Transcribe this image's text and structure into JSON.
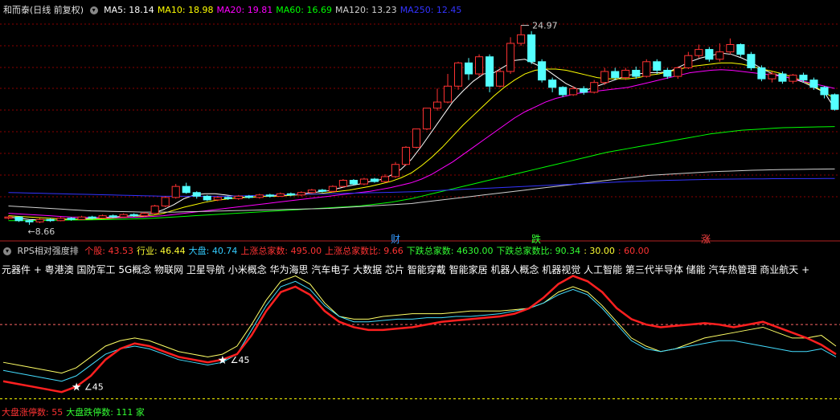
{
  "header": {
    "stock_title": "和而泰(日线 前复权)",
    "ma": [
      {
        "label": "MA5: 18.14",
        "color": "#ffffff"
      },
      {
        "label": "MA10: 18.98",
        "color": "#ffff00"
      },
      {
        "label": "MA20: 19.81",
        "color": "#ff00ff"
      },
      {
        "label": "MA60: 16.69",
        "color": "#00ff00"
      },
      {
        "label": "MA120: 13.23",
        "color": "#d0d0d0"
      },
      {
        "label": "MA250: 12.45",
        "color": "#3333ff"
      }
    ]
  },
  "price_chart": {
    "high_label": "24.97",
    "low_label": "8.66",
    "event_tags": [
      {
        "text": "财",
        "color": "#3399ff"
      },
      {
        "text": "跌",
        "color": "#33ff33"
      },
      {
        "text": "涨",
        "color": "#ff4444"
      }
    ],
    "candles": [
      {
        "o": 9.2,
        "c": 9.3,
        "h": 9.4,
        "l": 9.1
      },
      {
        "o": 9.3,
        "c": 9.0,
        "h": 9.35,
        "l": 8.9
      },
      {
        "o": 9.0,
        "c": 8.9,
        "h": 9.1,
        "l": 8.66
      },
      {
        "o": 8.9,
        "c": 9.1,
        "h": 9.2,
        "l": 8.8
      },
      {
        "o": 9.1,
        "c": 9.0,
        "h": 9.2,
        "l": 8.9
      },
      {
        "o": 9.0,
        "c": 9.2,
        "h": 9.3,
        "l": 8.95
      },
      {
        "o": 9.2,
        "c": 9.1,
        "h": 9.3,
        "l": 9.0
      },
      {
        "o": 9.1,
        "c": 9.3,
        "h": 9.4,
        "l": 9.05
      },
      {
        "o": 9.3,
        "c": 9.2,
        "h": 9.4,
        "l": 9.1
      },
      {
        "o": 9.2,
        "c": 9.4,
        "h": 9.5,
        "l": 9.15
      },
      {
        "o": 9.4,
        "c": 9.3,
        "h": 9.5,
        "l": 9.2
      },
      {
        "o": 9.3,
        "c": 9.5,
        "h": 9.6,
        "l": 9.25
      },
      {
        "o": 9.5,
        "c": 9.4,
        "h": 9.6,
        "l": 9.3
      },
      {
        "o": 9.4,
        "c": 9.6,
        "h": 9.7,
        "l": 9.35
      },
      {
        "o": 9.6,
        "c": 10.2,
        "h": 10.3,
        "l": 9.55
      },
      {
        "o": 10.2,
        "c": 10.9,
        "h": 11.0,
        "l": 10.1
      },
      {
        "o": 10.9,
        "c": 11.8,
        "h": 12.0,
        "l": 10.8
      },
      {
        "o": 11.8,
        "c": 11.3,
        "h": 12.1,
        "l": 11.2
      },
      {
        "o": 11.3,
        "c": 11.0,
        "h": 11.4,
        "l": 10.8
      },
      {
        "o": 11.0,
        "c": 10.7,
        "h": 11.1,
        "l": 10.6
      },
      {
        "o": 10.7,
        "c": 10.9,
        "h": 11.0,
        "l": 10.6
      },
      {
        "o": 10.9,
        "c": 10.8,
        "h": 11.0,
        "l": 10.7
      },
      {
        "o": 10.8,
        "c": 11.0,
        "h": 11.1,
        "l": 10.7
      },
      {
        "o": 11.0,
        "c": 10.9,
        "h": 11.1,
        "l": 10.8
      },
      {
        "o": 10.9,
        "c": 11.1,
        "h": 11.2,
        "l": 10.8
      },
      {
        "o": 11.1,
        "c": 11.0,
        "h": 11.2,
        "l": 10.9
      },
      {
        "o": 11.0,
        "c": 11.2,
        "h": 11.3,
        "l": 10.95
      },
      {
        "o": 11.2,
        "c": 11.1,
        "h": 11.3,
        "l": 11.0
      },
      {
        "o": 11.1,
        "c": 11.3,
        "h": 11.4,
        "l": 11.0
      },
      {
        "o": 11.3,
        "c": 11.5,
        "h": 11.6,
        "l": 11.2
      },
      {
        "o": 11.5,
        "c": 11.4,
        "h": 11.6,
        "l": 11.3
      },
      {
        "o": 11.4,
        "c": 11.8,
        "h": 11.9,
        "l": 11.3
      },
      {
        "o": 11.8,
        "c": 12.3,
        "h": 12.4,
        "l": 11.7
      },
      {
        "o": 12.3,
        "c": 12.0,
        "h": 12.4,
        "l": 11.9
      },
      {
        "o": 12.0,
        "c": 12.4,
        "h": 12.5,
        "l": 11.9
      },
      {
        "o": 12.4,
        "c": 12.2,
        "h": 12.5,
        "l": 12.1
      },
      {
        "o": 12.2,
        "c": 12.6,
        "h": 12.8,
        "l": 12.1
      },
      {
        "o": 12.6,
        "c": 13.6,
        "h": 13.8,
        "l": 12.5
      },
      {
        "o": 13.6,
        "c": 15.0,
        "h": 15.1,
        "l": 13.5
      },
      {
        "o": 15.0,
        "c": 16.5,
        "h": 16.5,
        "l": 14.9
      },
      {
        "o": 16.5,
        "c": 18.2,
        "h": 18.2,
        "l": 16.4
      },
      {
        "o": 18.2,
        "c": 18.7,
        "h": 19.8,
        "l": 18.0
      },
      {
        "o": 18.7,
        "c": 20.0,
        "h": 21.0,
        "l": 18.6
      },
      {
        "o": 20.0,
        "c": 21.9,
        "h": 22.0,
        "l": 19.7
      },
      {
        "o": 21.9,
        "c": 21.0,
        "h": 22.3,
        "l": 20.5
      },
      {
        "o": 21.0,
        "c": 22.4,
        "h": 22.6,
        "l": 20.8
      },
      {
        "o": 22.4,
        "c": 20.0,
        "h": 22.6,
        "l": 19.5
      },
      {
        "o": 20.0,
        "c": 21.2,
        "h": 21.5,
        "l": 19.9
      },
      {
        "o": 21.2,
        "c": 23.5,
        "h": 24.0,
        "l": 21.0
      },
      {
        "o": 23.5,
        "c": 24.2,
        "h": 24.97,
        "l": 23.3
      },
      {
        "o": 24.2,
        "c": 22.0,
        "h": 24.5,
        "l": 21.8
      },
      {
        "o": 22.0,
        "c": 20.5,
        "h": 22.2,
        "l": 20.3
      },
      {
        "o": 20.5,
        "c": 19.9,
        "h": 20.7,
        "l": 19.5
      },
      {
        "o": 19.9,
        "c": 19.3,
        "h": 20.0,
        "l": 19.1
      },
      {
        "o": 19.3,
        "c": 19.8,
        "h": 20.0,
        "l": 19.2
      },
      {
        "o": 19.8,
        "c": 19.5,
        "h": 20.0,
        "l": 19.3
      },
      {
        "o": 19.5,
        "c": 20.3,
        "h": 20.5,
        "l": 19.4
      },
      {
        "o": 20.3,
        "c": 21.2,
        "h": 21.5,
        "l": 20.1
      },
      {
        "o": 21.2,
        "c": 20.7,
        "h": 21.5,
        "l": 20.5
      },
      {
        "o": 20.7,
        "c": 21.3,
        "h": 21.5,
        "l": 20.5
      },
      {
        "o": 21.3,
        "c": 20.8,
        "h": 21.6,
        "l": 20.6
      },
      {
        "o": 20.8,
        "c": 22.0,
        "h": 22.2,
        "l": 20.7
      },
      {
        "o": 22.0,
        "c": 21.3,
        "h": 22.2,
        "l": 21.0
      },
      {
        "o": 21.3,
        "c": 20.8,
        "h": 21.5,
        "l": 20.6
      },
      {
        "o": 20.8,
        "c": 21.5,
        "h": 21.6,
        "l": 20.6
      },
      {
        "o": 21.5,
        "c": 22.5,
        "h": 22.8,
        "l": 21.4
      },
      {
        "o": 22.5,
        "c": 23.0,
        "h": 23.4,
        "l": 22.3
      },
      {
        "o": 23.0,
        "c": 22.2,
        "h": 23.2,
        "l": 22.0
      },
      {
        "o": 22.2,
        "c": 22.8,
        "h": 23.5,
        "l": 22.0
      },
      {
        "o": 22.8,
        "c": 23.4,
        "h": 23.9,
        "l": 22.6
      },
      {
        "o": 23.4,
        "c": 22.6,
        "h": 23.5,
        "l": 22.4
      },
      {
        "o": 22.6,
        "c": 21.5,
        "h": 22.8,
        "l": 21.3
      },
      {
        "o": 21.5,
        "c": 20.6,
        "h": 21.7,
        "l": 20.4
      },
      {
        "o": 20.6,
        "c": 21.0,
        "h": 21.2,
        "l": 20.3
      },
      {
        "o": 21.0,
        "c": 20.4,
        "h": 21.2,
        "l": 20.2
      },
      {
        "o": 20.4,
        "c": 20.9,
        "h": 21.0,
        "l": 20.2
      },
      {
        "o": 20.9,
        "c": 20.5,
        "h": 21.1,
        "l": 20.3
      },
      {
        "o": 20.5,
        "c": 19.9,
        "h": 20.7,
        "l": 19.7
      },
      {
        "o": 19.9,
        "c": 19.3,
        "h": 20.0,
        "l": 19.0
      },
      {
        "o": 19.3,
        "c": 18.1,
        "h": 19.4,
        "l": 18.0
      }
    ],
    "ma_values": {
      "ma5": [
        9.3,
        9.2,
        9.1,
        9.05,
        9.05,
        9.06,
        9.1,
        9.14,
        9.2,
        9.25,
        9.3,
        9.35,
        9.4,
        9.45,
        9.6,
        9.9,
        10.3,
        10.8,
        11.1,
        11.2,
        11.2,
        11.1,
        11.0,
        10.9,
        10.95,
        11.0,
        11.05,
        11.1,
        11.15,
        11.25,
        11.35,
        11.45,
        11.65,
        11.85,
        12.0,
        12.2,
        12.35,
        12.7,
        13.2,
        14.0,
        15.1,
        16.3,
        17.5,
        18.7,
        19.6,
        20.4,
        21.0,
        21.1,
        21.6,
        22.1,
        22.2,
        21.8,
        21.4,
        20.8,
        20.2,
        19.8,
        19.7,
        20.0,
        20.3,
        20.6,
        20.9,
        21.0,
        21.1,
        21.1,
        21.2,
        21.6,
        22.0,
        22.3,
        22.5,
        22.7,
        22.6,
        22.3,
        21.9,
        21.4,
        21.0,
        20.8,
        20.6,
        20.3,
        19.9,
        19.5,
        18.14
      ],
      "ma10": [
        9.4,
        9.35,
        9.3,
        9.25,
        9.2,
        9.15,
        9.12,
        9.1,
        9.12,
        9.15,
        9.2,
        9.25,
        9.3,
        9.35,
        9.45,
        9.6,
        9.85,
        10.1,
        10.3,
        10.5,
        10.65,
        10.75,
        10.85,
        10.9,
        10.95,
        11.0,
        11.0,
        11.05,
        11.1,
        11.15,
        11.2,
        11.3,
        11.4,
        11.5,
        11.65,
        11.8,
        12.0,
        12.2,
        12.5,
        12.9,
        13.5,
        14.2,
        15.0,
        15.9,
        16.8,
        17.6,
        18.4,
        19.2,
        19.9,
        20.5,
        21.0,
        21.3,
        21.4,
        21.4,
        21.3,
        21.1,
        20.9,
        20.7,
        20.6,
        20.6,
        20.6,
        20.7,
        20.9,
        21.0,
        21.2,
        21.4,
        21.6,
        21.7,
        21.8,
        21.9,
        21.9,
        21.8,
        21.6,
        21.4,
        21.2,
        21.0,
        20.7,
        20.4,
        20.0,
        19.5,
        18.98
      ],
      "ma20": [
        9.6,
        9.55,
        9.5,
        9.45,
        9.4,
        9.35,
        9.3,
        9.28,
        9.26,
        9.25,
        9.25,
        9.26,
        9.28,
        9.3,
        9.35,
        9.4,
        9.5,
        9.6,
        9.7,
        9.8,
        9.9,
        10.0,
        10.1,
        10.2,
        10.3,
        10.4,
        10.5,
        10.6,
        10.7,
        10.8,
        10.9,
        11.0,
        11.1,
        11.2,
        11.3,
        11.4,
        11.55,
        11.7,
        11.9,
        12.1,
        12.4,
        12.8,
        13.3,
        13.8,
        14.4,
        15.0,
        15.6,
        16.2,
        16.8,
        17.4,
        17.9,
        18.3,
        18.7,
        19.0,
        19.2,
        19.4,
        19.5,
        19.6,
        19.7,
        19.8,
        19.9,
        20.1,
        20.3,
        20.5,
        20.7,
        20.9,
        21.1,
        21.2,
        21.3,
        21.35,
        21.3,
        21.2,
        21.1,
        21.0,
        20.9,
        20.8,
        20.6,
        20.4,
        20.2,
        20.0,
        19.81
      ],
      "ma60": [
        9.0,
        9.0,
        9.01,
        9.02,
        9.03,
        9.04,
        9.05,
        9.06,
        9.07,
        9.08,
        9.1,
        9.12,
        9.14,
        9.16,
        9.2,
        9.25,
        9.3,
        9.35,
        9.4,
        9.45,
        9.5,
        9.55,
        9.6,
        9.65,
        9.7,
        9.75,
        9.8,
        9.85,
        9.9,
        9.95,
        10.0,
        10.05,
        10.1,
        10.15,
        10.2,
        10.3,
        10.4,
        10.5,
        10.65,
        10.8,
        11.0,
        11.2,
        11.4,
        11.6,
        11.8,
        12.0,
        12.2,
        12.4,
        12.6,
        12.8,
        13.0,
        13.2,
        13.4,
        13.6,
        13.8,
        14.0,
        14.2,
        14.4,
        14.6,
        14.75,
        14.9,
        15.05,
        15.2,
        15.35,
        15.5,
        15.65,
        15.8,
        15.95,
        16.1,
        16.2,
        16.3,
        16.4,
        16.45,
        16.5,
        16.55,
        16.6,
        16.62,
        16.64,
        16.66,
        16.68,
        16.69
      ],
      "ma120": [
        10.2,
        10.15,
        10.1,
        10.05,
        10.0,
        9.95,
        9.9,
        9.85,
        9.8,
        9.78,
        9.76,
        9.74,
        9.72,
        9.7,
        9.7,
        9.7,
        9.7,
        9.72,
        9.74,
        9.76,
        9.78,
        9.8,
        9.82,
        9.84,
        9.86,
        9.88,
        9.9,
        9.92,
        9.94,
        9.96,
        9.98,
        10.0,
        10.05,
        10.1,
        10.15,
        10.2,
        10.25,
        10.3,
        10.35,
        10.4,
        10.5,
        10.6,
        10.7,
        10.8,
        10.9,
        11.0,
        11.1,
        11.2,
        11.3,
        11.4,
        11.5,
        11.6,
        11.7,
        11.8,
        11.9,
        12.0,
        12.1,
        12.2,
        12.3,
        12.4,
        12.5,
        12.6,
        12.7,
        12.75,
        12.8,
        12.85,
        12.9,
        12.95,
        13.0,
        13.03,
        13.06,
        13.09,
        13.12,
        13.14,
        13.16,
        13.18,
        13.19,
        13.2,
        13.21,
        13.22,
        13.23
      ],
      "ma250": [
        11.3,
        11.28,
        11.26,
        11.24,
        11.22,
        11.2,
        11.18,
        11.16,
        11.14,
        11.12,
        11.1,
        11.08,
        11.06,
        11.04,
        11.02,
        11.0,
        11.0,
        11.0,
        11.0,
        11.0,
        11.0,
        11.0,
        11.02,
        11.04,
        11.06,
        11.08,
        11.1,
        11.12,
        11.14,
        11.16,
        11.18,
        11.2,
        11.22,
        11.24,
        11.26,
        11.28,
        11.3,
        11.32,
        11.34,
        11.36,
        11.4,
        11.44,
        11.48,
        11.52,
        11.56,
        11.6,
        11.64,
        11.68,
        11.72,
        11.76,
        11.8,
        11.84,
        11.88,
        11.92,
        11.96,
        12.0,
        12.04,
        12.08,
        12.12,
        12.16,
        12.2,
        12.23,
        12.26,
        12.28,
        12.3,
        12.32,
        12.34,
        12.36,
        12.38,
        12.39,
        12.4,
        12.41,
        12.42,
        12.42,
        12.43,
        12.43,
        12.44,
        12.44,
        12.44,
        12.45,
        12.45
      ]
    }
  },
  "rps_panel": {
    "title": "RPS相对强度排",
    "stats": [
      {
        "label": "个股: 43.53",
        "color": "#ff3333"
      },
      {
        "label": "行业: 46.44",
        "color": "#ffff33"
      },
      {
        "label": "大盘: 40.74",
        "color": "#33ccff"
      },
      {
        "label": "上涨总家数: 495.00",
        "color": "#ff3333"
      },
      {
        "label": "上涨总家数比: 9.66",
        "color": "#ff3333"
      },
      {
        "label": "下跌总家数: 4630.00",
        "color": "#33ff33"
      },
      {
        "label": "下跌总家数比: 90.34",
        "color": "#33ff33"
      },
      {
        "label": ": 30.00",
        "color": "#ffff33"
      },
      {
        "label": ": 60.00",
        "color": "#ff3333"
      }
    ],
    "concepts": "元器件 + 粤港澳 国防军工 5G概念 物联网 卫星导航 小米概念 华为海思 汽车电子 大数据 芯片 智能穿戴 智能家居 机器人概念 机器视觉 人工智能 第三代半导体 储能 汽车热管理 商业航天 +",
    "markers": [
      {
        "text": "45"
      },
      {
        "text": "45"
      }
    ],
    "series_stock": [
      18,
      16,
      14,
      12,
      10,
      14,
      22,
      34,
      42,
      46,
      44,
      40,
      36,
      34,
      32,
      34,
      38,
      52,
      70,
      84,
      88,
      82,
      70,
      62,
      58,
      56,
      56,
      57,
      58,
      60,
      62,
      63,
      64,
      65,
      66,
      68,
      72,
      80,
      90,
      96,
      92,
      84,
      72,
      64,
      60,
      58,
      59,
      60,
      61,
      60,
      58,
      60,
      62,
      58,
      54,
      50,
      45,
      38
    ],
    "series_industry": [
      32,
      30,
      28,
      26,
      24,
      28,
      36,
      44,
      48,
      50,
      48,
      44,
      40,
      38,
      36,
      38,
      44,
      60,
      78,
      92,
      96,
      90,
      76,
      66,
      64,
      64,
      66,
      67,
      68,
      68,
      68,
      69,
      70,
      70,
      70,
      71,
      72,
      76,
      84,
      88,
      84,
      74,
      62,
      50,
      44,
      40,
      42,
      46,
      50,
      52,
      54,
      56,
      58,
      54,
      50,
      50,
      52,
      44
    ],
    "series_market": [
      26,
      24,
      22,
      20,
      18,
      22,
      30,
      38,
      42,
      44,
      42,
      38,
      34,
      32,
      30,
      32,
      38,
      56,
      74,
      88,
      92,
      86,
      74,
      66,
      62,
      62,
      63,
      64,
      64,
      65,
      65,
      66,
      66,
      67,
      68,
      70,
      72,
      76,
      82,
      86,
      82,
      72,
      60,
      48,
      42,
      40,
      42,
      44,
      46,
      48,
      48,
      46,
      44,
      42,
      40,
      40,
      42,
      36
    ],
    "bottom": [
      {
        "label": "大盘涨停数: 55",
        "color": "#ff3333"
      },
      {
        "label": "大盘跌停数: 111 家",
        "color": "#33ff33"
      }
    ]
  },
  "chart_data": [
    {
      "type": "candlestick",
      "title": "和而泰(日线 前复权)",
      "series": [
        "MA5",
        "MA10",
        "MA20",
        "MA60",
        "MA120",
        "MA250"
      ],
      "high": 24.97,
      "low": 8.66
    },
    {
      "type": "line",
      "title": "RPS相对强度排",
      "series": [
        {
          "name": "个股",
          "last": 43.53
        },
        {
          "name": "行业",
          "last": 46.44
        },
        {
          "name": "大盘",
          "last": 40.74
        }
      ],
      "reference_lines": [
        30,
        60
      ]
    }
  ]
}
